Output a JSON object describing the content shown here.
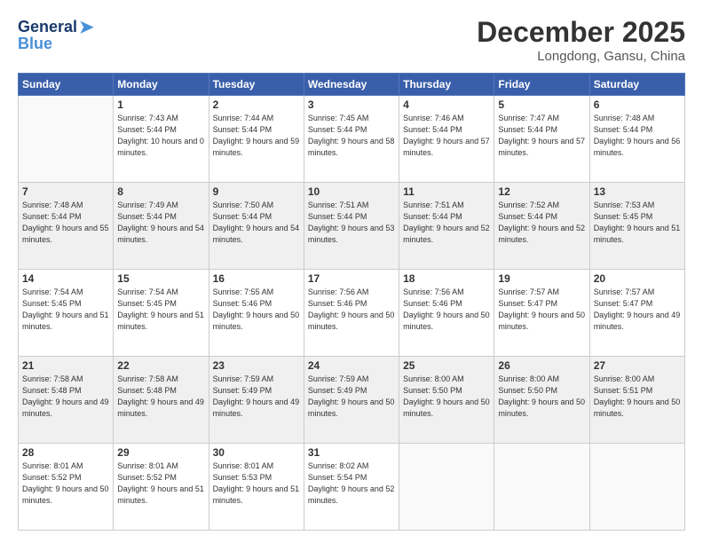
{
  "logo": {
    "general": "General",
    "blue": "Blue"
  },
  "title": "December 2025",
  "location": "Longdong, Gansu, China",
  "weekdays": [
    "Sunday",
    "Monday",
    "Tuesday",
    "Wednesday",
    "Thursday",
    "Friday",
    "Saturday"
  ],
  "weeks": [
    [
      {
        "day": "",
        "sunrise": "",
        "sunset": "",
        "daylight": ""
      },
      {
        "day": "1",
        "sunrise": "Sunrise: 7:43 AM",
        "sunset": "Sunset: 5:44 PM",
        "daylight": "Daylight: 10 hours and 0 minutes."
      },
      {
        "day": "2",
        "sunrise": "Sunrise: 7:44 AM",
        "sunset": "Sunset: 5:44 PM",
        "daylight": "Daylight: 9 hours and 59 minutes."
      },
      {
        "day": "3",
        "sunrise": "Sunrise: 7:45 AM",
        "sunset": "Sunset: 5:44 PM",
        "daylight": "Daylight: 9 hours and 58 minutes."
      },
      {
        "day": "4",
        "sunrise": "Sunrise: 7:46 AM",
        "sunset": "Sunset: 5:44 PM",
        "daylight": "Daylight: 9 hours and 57 minutes."
      },
      {
        "day": "5",
        "sunrise": "Sunrise: 7:47 AM",
        "sunset": "Sunset: 5:44 PM",
        "daylight": "Daylight: 9 hours and 57 minutes."
      },
      {
        "day": "6",
        "sunrise": "Sunrise: 7:48 AM",
        "sunset": "Sunset: 5:44 PM",
        "daylight": "Daylight: 9 hours and 56 minutes."
      }
    ],
    [
      {
        "day": "7",
        "sunrise": "Sunrise: 7:48 AM",
        "sunset": "Sunset: 5:44 PM",
        "daylight": "Daylight: 9 hours and 55 minutes."
      },
      {
        "day": "8",
        "sunrise": "Sunrise: 7:49 AM",
        "sunset": "Sunset: 5:44 PM",
        "daylight": "Daylight: 9 hours and 54 minutes."
      },
      {
        "day": "9",
        "sunrise": "Sunrise: 7:50 AM",
        "sunset": "Sunset: 5:44 PM",
        "daylight": "Daylight: 9 hours and 54 minutes."
      },
      {
        "day": "10",
        "sunrise": "Sunrise: 7:51 AM",
        "sunset": "Sunset: 5:44 PM",
        "daylight": "Daylight: 9 hours and 53 minutes."
      },
      {
        "day": "11",
        "sunrise": "Sunrise: 7:51 AM",
        "sunset": "Sunset: 5:44 PM",
        "daylight": "Daylight: 9 hours and 52 minutes."
      },
      {
        "day": "12",
        "sunrise": "Sunrise: 7:52 AM",
        "sunset": "Sunset: 5:44 PM",
        "daylight": "Daylight: 9 hours and 52 minutes."
      },
      {
        "day": "13",
        "sunrise": "Sunrise: 7:53 AM",
        "sunset": "Sunset: 5:45 PM",
        "daylight": "Daylight: 9 hours and 51 minutes."
      }
    ],
    [
      {
        "day": "14",
        "sunrise": "Sunrise: 7:54 AM",
        "sunset": "Sunset: 5:45 PM",
        "daylight": "Daylight: 9 hours and 51 minutes."
      },
      {
        "day": "15",
        "sunrise": "Sunrise: 7:54 AM",
        "sunset": "Sunset: 5:45 PM",
        "daylight": "Daylight: 9 hours and 51 minutes."
      },
      {
        "day": "16",
        "sunrise": "Sunrise: 7:55 AM",
        "sunset": "Sunset: 5:46 PM",
        "daylight": "Daylight: 9 hours and 50 minutes."
      },
      {
        "day": "17",
        "sunrise": "Sunrise: 7:56 AM",
        "sunset": "Sunset: 5:46 PM",
        "daylight": "Daylight: 9 hours and 50 minutes."
      },
      {
        "day": "18",
        "sunrise": "Sunrise: 7:56 AM",
        "sunset": "Sunset: 5:46 PM",
        "daylight": "Daylight: 9 hours and 50 minutes."
      },
      {
        "day": "19",
        "sunrise": "Sunrise: 7:57 AM",
        "sunset": "Sunset: 5:47 PM",
        "daylight": "Daylight: 9 hours and 50 minutes."
      },
      {
        "day": "20",
        "sunrise": "Sunrise: 7:57 AM",
        "sunset": "Sunset: 5:47 PM",
        "daylight": "Daylight: 9 hours and 49 minutes."
      }
    ],
    [
      {
        "day": "21",
        "sunrise": "Sunrise: 7:58 AM",
        "sunset": "Sunset: 5:48 PM",
        "daylight": "Daylight: 9 hours and 49 minutes."
      },
      {
        "day": "22",
        "sunrise": "Sunrise: 7:58 AM",
        "sunset": "Sunset: 5:48 PM",
        "daylight": "Daylight: 9 hours and 49 minutes."
      },
      {
        "day": "23",
        "sunrise": "Sunrise: 7:59 AM",
        "sunset": "Sunset: 5:49 PM",
        "daylight": "Daylight: 9 hours and 49 minutes."
      },
      {
        "day": "24",
        "sunrise": "Sunrise: 7:59 AM",
        "sunset": "Sunset: 5:49 PM",
        "daylight": "Daylight: 9 hours and 50 minutes."
      },
      {
        "day": "25",
        "sunrise": "Sunrise: 8:00 AM",
        "sunset": "Sunset: 5:50 PM",
        "daylight": "Daylight: 9 hours and 50 minutes."
      },
      {
        "day": "26",
        "sunrise": "Sunrise: 8:00 AM",
        "sunset": "Sunset: 5:50 PM",
        "daylight": "Daylight: 9 hours and 50 minutes."
      },
      {
        "day": "27",
        "sunrise": "Sunrise: 8:00 AM",
        "sunset": "Sunset: 5:51 PM",
        "daylight": "Daylight: 9 hours and 50 minutes."
      }
    ],
    [
      {
        "day": "28",
        "sunrise": "Sunrise: 8:01 AM",
        "sunset": "Sunset: 5:52 PM",
        "daylight": "Daylight: 9 hours and 50 minutes."
      },
      {
        "day": "29",
        "sunrise": "Sunrise: 8:01 AM",
        "sunset": "Sunset: 5:52 PM",
        "daylight": "Daylight: 9 hours and 51 minutes."
      },
      {
        "day": "30",
        "sunrise": "Sunrise: 8:01 AM",
        "sunset": "Sunset: 5:53 PM",
        "daylight": "Daylight: 9 hours and 51 minutes."
      },
      {
        "day": "31",
        "sunrise": "Sunrise: 8:02 AM",
        "sunset": "Sunset: 5:54 PM",
        "daylight": "Daylight: 9 hours and 52 minutes."
      },
      {
        "day": "",
        "sunrise": "",
        "sunset": "",
        "daylight": ""
      },
      {
        "day": "",
        "sunrise": "",
        "sunset": "",
        "daylight": ""
      },
      {
        "day": "",
        "sunrise": "",
        "sunset": "",
        "daylight": ""
      }
    ]
  ]
}
